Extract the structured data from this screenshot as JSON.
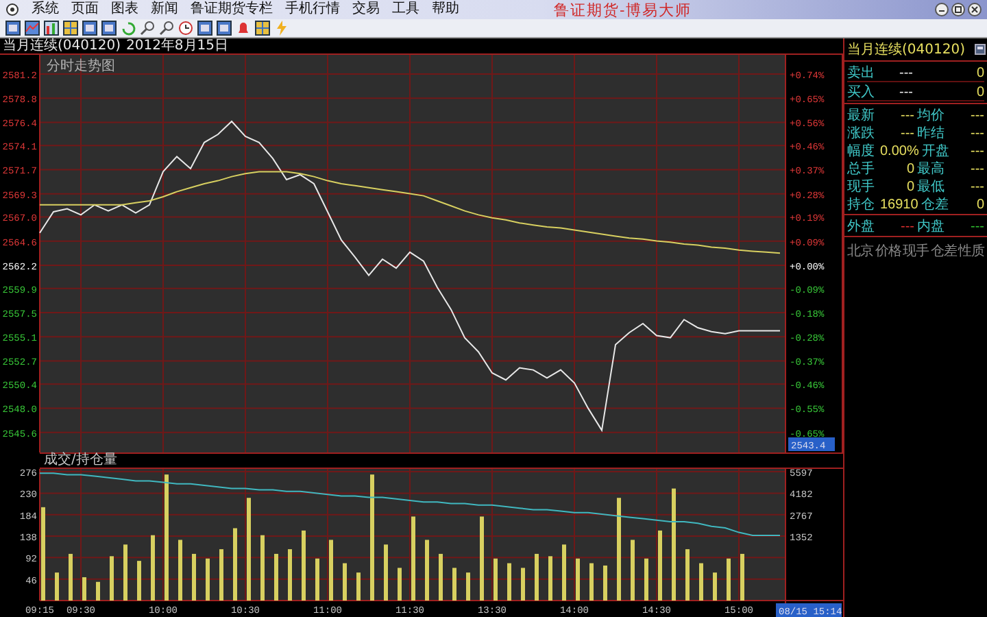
{
  "title_bar": {
    "menu": [
      "系统",
      "页面",
      "图表",
      "新闻",
      "鲁证期货专栏",
      "手机行情",
      "交易",
      "工具",
      "帮助"
    ],
    "title": "鲁证期货-博易大师"
  },
  "info_bar": {
    "instrument": "当月连续(040120)",
    "date": "2012年8月15日"
  },
  "price_panel": {
    "title": "分时走势图",
    "cursor_price": "2543.4",
    "percent_labels": [
      "+0.74%",
      "+0.65%",
      "+0.56%",
      "+0.46%",
      "+0.37%",
      "+0.28%",
      "+0.19%",
      "+0.09%",
      "+0.00%",
      "-0.09%",
      "-0.18%",
      "-0.28%",
      "-0.37%",
      "-0.46%",
      "-0.55%",
      "-0.65%"
    ],
    "chart_data": {
      "type": "line",
      "grid": true,
      "ylim": [
        2543.6,
        2583.1
      ],
      "yticks": [
        {
          "value": 2581.2,
          "label": "2581.2"
        },
        {
          "value": 2578.8,
          "label": "2578.8"
        },
        {
          "value": 2576.4,
          "label": "2576.4"
        },
        {
          "value": 2574.1,
          "label": "2574.1"
        },
        {
          "value": 2571.7,
          "label": "2571.7"
        },
        {
          "value": 2569.3,
          "label": "2569.3"
        },
        {
          "value": 2567.0,
          "label": "2567.0"
        },
        {
          "value": 2564.6,
          "label": "2564.6"
        },
        {
          "value": 2562.2,
          "label": "2562.2"
        },
        {
          "value": 2559.9,
          "label": "2559.9"
        },
        {
          "value": 2557.5,
          "label": "2557.5"
        },
        {
          "value": 2555.1,
          "label": "2555.1"
        },
        {
          "value": 2552.7,
          "label": "2552.7"
        },
        {
          "value": 2550.4,
          "label": "2550.4"
        },
        {
          "value": 2548.0,
          "label": "2548.0"
        },
        {
          "value": 2545.6,
          "label": "2545.6"
        }
      ],
      "series": [
        {
          "color": "#e8e8e8",
          "values": [
            2565.4,
            2567.5,
            2567.8,
            2567.2,
            2568.2,
            2567.6,
            2568.2,
            2567.4,
            2568.2,
            2571.5,
            2573.0,
            2571.8,
            2574.4,
            2575.2,
            2576.5,
            2575.0,
            2574.4,
            2572.8,
            2570.7,
            2571.2,
            2570.3,
            2567.5,
            2564.7,
            2563.0,
            2561.2,
            2562.8,
            2561.9,
            2563.5,
            2562.6,
            2560.0,
            2557.8,
            2555.0,
            2553.6,
            2551.5,
            2550.8,
            2552.0,
            2551.8,
            2551.0,
            2551.8,
            2550.5,
            2548.0,
            2545.8,
            2554.3,
            2555.5,
            2556.4,
            2555.2,
            2555.0,
            2556.8,
            2556.0,
            2555.6,
            2555.4,
            2555.7,
            2555.7,
            2555.7,
            2555.7
          ]
        },
        {
          "color": "#d8d060",
          "values": [
            2568.2,
            2568.2,
            2568.2,
            2568.2,
            2568.2,
            2568.2,
            2568.2,
            2568.4,
            2568.6,
            2569.0,
            2569.5,
            2569.9,
            2570.3,
            2570.6,
            2571.0,
            2571.3,
            2571.5,
            2571.5,
            2571.5,
            2571.3,
            2571.0,
            2570.6,
            2570.3,
            2570.1,
            2569.9,
            2569.7,
            2569.5,
            2569.3,
            2569.1,
            2568.6,
            2568.1,
            2567.6,
            2567.2,
            2566.9,
            2566.7,
            2566.4,
            2566.2,
            2566.0,
            2565.9,
            2565.7,
            2565.5,
            2565.3,
            2565.1,
            2564.9,
            2564.8,
            2564.6,
            2564.5,
            2564.3,
            2564.2,
            2564.0,
            2563.9,
            2563.7,
            2563.6,
            2563.5,
            2563.4
          ]
        }
      ]
    }
  },
  "volume_panel": {
    "title": "成交/持仓量",
    "cursor_time": "08/15 15:14",
    "volume_chart": {
      "chart_data": {
        "type": "bar",
        "grid": true,
        "categories": [
          "09:15",
          null,
          null,
          "09:30",
          null,
          null,
          null,
          null,
          null,
          "10:00",
          null,
          null,
          null,
          null,
          null,
          "10:30",
          null,
          null,
          null,
          null,
          null,
          "11:00",
          null,
          null,
          null,
          null,
          null,
          "11:30",
          null,
          null,
          null,
          null,
          null,
          "13:30",
          null,
          null,
          null,
          null,
          null,
          "14:00",
          null,
          null,
          null,
          null,
          null,
          "14:30",
          null,
          null,
          null,
          null,
          null,
          "15:00",
          null,
          null,
          null
        ],
        "ylim": [
          0,
          282
        ],
        "yticks": [
          {
            "value": 276,
            "label": "276"
          },
          {
            "value": 230,
            "label": "230"
          },
          {
            "value": 184,
            "label": "184"
          },
          {
            "value": 138,
            "label": "138"
          },
          {
            "value": 92,
            "label": "92"
          },
          {
            "value": 46,
            "label": "46"
          }
        ],
        "series": [
          {
            "color": "#d8d060",
            "values": [
              200,
              60,
              100,
              50,
              40,
              95,
              120,
              85,
              140,
              270,
              130,
              100,
              90,
              110,
              155,
              220,
              140,
              100,
              110,
              150,
              90,
              130,
              80,
              60,
              270,
              120,
              70,
              180,
              130,
              100,
              70,
              60,
              180,
              90,
              80,
              70,
              100,
              95,
              120,
              90,
              80,
              75,
              220,
              130,
              90,
              150,
              240,
              110,
              80,
              60,
              90,
              100,
              null,
              null,
              null
            ]
          }
        ]
      }
    },
    "open_interest_chart": {
      "chart_data": {
        "type": "line",
        "ylim": [
          -3978,
          5782
        ],
        "yticks": [
          {
            "value": 5597,
            "label": "5597"
          },
          {
            "value": 4182,
            "label": "4182"
          },
          {
            "value": 2767,
            "label": "2767"
          },
          {
            "value": 1352,
            "label": "1352"
          }
        ],
        "series": [
          {
            "color": "#40b8c0",
            "values": [
              5500,
              5500,
              5400,
              5400,
              5300,
              5200,
              5100,
              5000,
              5000,
              4900,
              4800,
              4800,
              4700,
              4600,
              4500,
              4500,
              4400,
              4400,
              4300,
              4300,
              4200,
              4100,
              4000,
              4000,
              3900,
              3900,
              3800,
              3700,
              3600,
              3600,
              3500,
              3500,
              3400,
              3400,
              3300,
              3200,
              3100,
              3100,
              3000,
              2900,
              2900,
              2800,
              2700,
              2600,
              2500,
              2400,
              2300,
              2300,
              2200,
              2000,
              1900,
              1600,
              1400,
              1400,
              1400
            ]
          }
        ]
      }
    }
  },
  "quote_panel": {
    "title": "当月连续(040120)",
    "order_book": [
      {
        "label": "卖出",
        "price": "---",
        "volume": "0"
      },
      {
        "label": "买入",
        "price": "---",
        "volume": "0"
      }
    ],
    "stats": [
      {
        "left": {
          "label": "最新",
          "value": "---"
        },
        "right": {
          "label": "均价",
          "value": "---"
        }
      },
      {
        "left": {
          "label": "涨跌",
          "value": "---"
        },
        "right": {
          "label": "昨结",
          "value": "---"
        }
      },
      {
        "left": {
          "label": "幅度",
          "value": "0.00%"
        },
        "right": {
          "label": "开盘",
          "value": "---"
        }
      },
      {
        "left": {
          "label": "总手",
          "value": "0"
        },
        "right": {
          "label": "最高",
          "value": "---"
        }
      },
      {
        "left": {
          "label": "现手",
          "value": "0"
        },
        "right": {
          "label": "最低",
          "value": "---"
        }
      },
      {
        "left": {
          "label": "持仓",
          "value": "16910"
        },
        "right": {
          "label": "仓差",
          "value": "0"
        }
      }
    ],
    "volume_split": [
      {
        "label": "外盘",
        "value": "---",
        "color": "#e03030"
      },
      {
        "label": "内盘",
        "value": "---",
        "color": "#30c030"
      }
    ],
    "trade_columns": [
      "北京",
      "价格",
      "现手",
      "仓差",
      "性质"
    ]
  }
}
